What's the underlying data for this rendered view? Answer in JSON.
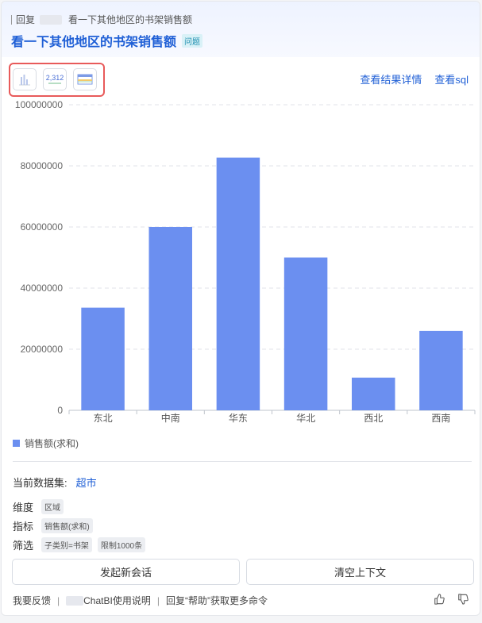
{
  "header": {
    "reply_prefix": "回复",
    "reply_text": "看一下其他地区的书架销售额",
    "title": "看一下其他地区的书架销售额",
    "question_tag": "问题"
  },
  "toolbar": {
    "icons": [
      "bar-chart-icon",
      "number-card-icon",
      "table-icon"
    ],
    "number_card_value": "2,312"
  },
  "links": {
    "result_detail": "查看结果详情",
    "view_sql": "查看sql"
  },
  "chart_data": {
    "type": "bar",
    "categories": [
      "东北",
      "中南",
      "华东",
      "华北",
      "西北",
      "西南"
    ],
    "values": [
      33600000,
      60000000,
      82700000,
      50000000,
      10700000,
      26000000
    ],
    "ylim": [
      0,
      100000000
    ],
    "yticks": [
      0,
      20000000,
      40000000,
      60000000,
      80000000,
      100000000
    ],
    "series": [
      {
        "name": "销售额(求和)"
      }
    ],
    "legend_position": "bottom-left",
    "color": "#6b8ff0",
    "grid": true
  },
  "dataset": {
    "label": "当前数据集:",
    "value": "超市"
  },
  "meta": {
    "dimension_label": "维度",
    "dimension_chips": [
      "区域"
    ],
    "metric_label": "指标",
    "metric_chips": [
      "销售额(求和)"
    ],
    "filter_label": "筛选",
    "filter_chips": [
      "子类别=书架",
      "限制1000条"
    ]
  },
  "buttons": {
    "new_session": "发起新会话",
    "clear_context": "清空上下文"
  },
  "footer": {
    "feedback": "我要反馈",
    "manual": "ChatBI使用说明",
    "help_hint": "回复“帮助”获取更多命令"
  }
}
